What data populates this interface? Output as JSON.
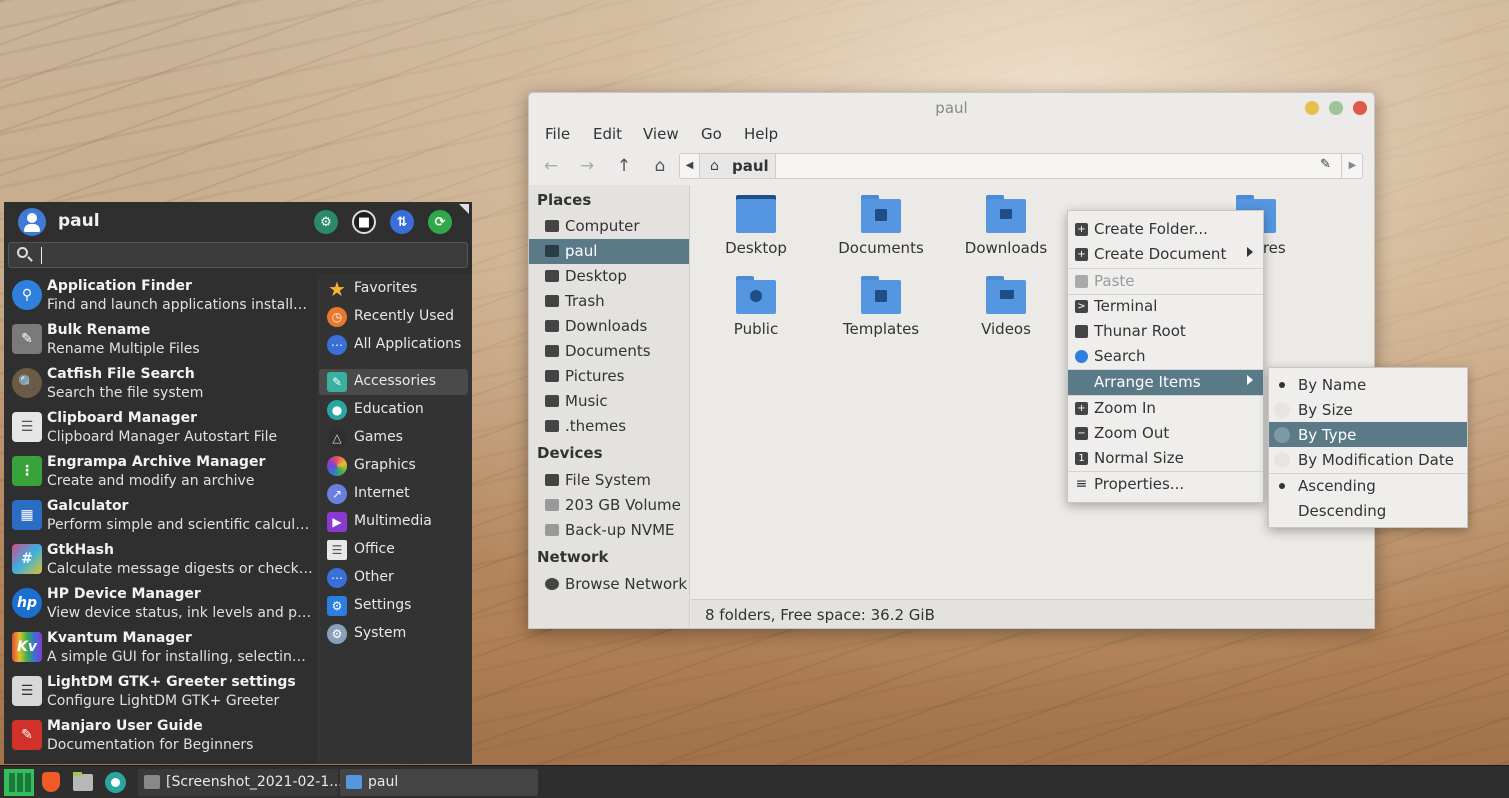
{
  "whisker_menu": {
    "username": "paul",
    "search_value": "",
    "applications": [
      {
        "name": "Application Finder",
        "desc": "Find and launch applications installe...",
        "icon": "search-icon",
        "color": "#2f7fdc"
      },
      {
        "name": "Bulk Rename",
        "desc": "Rename Multiple Files",
        "icon": "bulk-rename-icon",
        "color": "#7a7a7a"
      },
      {
        "name": "Catfish File Search",
        "desc": "Search the file system",
        "icon": "catfish-icon",
        "color": "#6b5a45"
      },
      {
        "name": "Clipboard Manager",
        "desc": "Clipboard Manager Autostart File",
        "icon": "clipboard-icon",
        "color": "#e6e6e6"
      },
      {
        "name": "Engrampa Archive Manager",
        "desc": "Create and modify an archive",
        "icon": "archive-icon",
        "color": "#3aa23a"
      },
      {
        "name": "Galculator",
        "desc": "Perform simple and scientific calcula...",
        "icon": "calculator-icon",
        "color": "#2b6cc4"
      },
      {
        "name": "GtkHash",
        "desc": "Calculate message digests or checks...",
        "icon": "hash-icon",
        "color": "#d24a8a"
      },
      {
        "name": "HP Device Manager",
        "desc": "View device status, ink levels and per...",
        "icon": "hp-icon",
        "color": "#1a6fd1"
      },
      {
        "name": "Kvantum Manager",
        "desc": "A simple GUI for installing, selecting ...",
        "icon": "kvantum-icon",
        "color": "#e04a3a"
      },
      {
        "name": "LightDM GTK+ Greeter settings",
        "desc": "Configure LightDM GTK+ Greeter",
        "icon": "settings-icon",
        "color": "#d8d8d8"
      },
      {
        "name": "Manjaro User Guide",
        "desc": "Documentation for Beginners",
        "icon": "pdf-icon",
        "color": "#d2302a"
      }
    ],
    "categories": [
      {
        "label": "Favorites",
        "icon": "star-icon",
        "color": "#f2b632"
      },
      {
        "label": "Recently Used",
        "icon": "clock-icon",
        "color": "#e8792c"
      },
      {
        "label": "All Applications",
        "icon": "grid-icon",
        "color": "#3a6fd8"
      },
      {
        "label": "Accessories",
        "icon": "accessories-icon",
        "color": "#3ab0a0"
      },
      {
        "label": "Education",
        "icon": "education-icon",
        "color": "#2aa6a0"
      },
      {
        "label": "Games",
        "icon": "gamepad-icon",
        "color": "#555555"
      },
      {
        "label": "Graphics",
        "icon": "graphics-icon",
        "color": "#e84e6a"
      },
      {
        "label": "Internet",
        "icon": "globe-icon",
        "color": "#6b7fe0"
      },
      {
        "label": "Multimedia",
        "icon": "multimedia-icon",
        "color": "#8a3ad0"
      },
      {
        "label": "Office",
        "icon": "office-icon",
        "color": "#e8e8e8"
      },
      {
        "label": "Other",
        "icon": "other-icon",
        "color": "#3a6fd8"
      },
      {
        "label": "Settings",
        "icon": "settings-icon",
        "color": "#2a7fe0"
      },
      {
        "label": "System",
        "icon": "system-icon",
        "color": "#8aa0b8"
      }
    ]
  },
  "panel": {
    "tasks": [
      {
        "label": "[Screenshot_2021-02-1...",
        "icon": "screenshot-icon"
      },
      {
        "label": "paul",
        "icon": "folder-icon"
      }
    ]
  },
  "thunar": {
    "title": "paul",
    "menu": [
      "File",
      "Edit",
      "View",
      "Go",
      "Help"
    ],
    "path_crumb": "paul",
    "sidebar": {
      "places_header": "Places",
      "places": [
        "Computer",
        "paul",
        "Desktop",
        "Trash",
        "Downloads",
        "Documents",
        "Pictures",
        "Music",
        ".themes"
      ],
      "devices_header": "Devices",
      "devices": [
        "File System",
        "203 GB Volume",
        "Back-up NVME"
      ],
      "network_header": "Network",
      "network": [
        "Browse Network"
      ]
    },
    "folders": [
      "Desktop",
      "Documents",
      "Downloads",
      "Public",
      "Templates",
      "Videos",
      "Pictures"
    ],
    "status": "8 folders, Free space: 36.2 GiB"
  },
  "context_menu": {
    "items": [
      {
        "label": "Create Folder...",
        "icon": "plus-icon"
      },
      {
        "label": "Create Document",
        "icon": "plus-icon",
        "submenu": true
      },
      {
        "label": "Paste",
        "icon": "paste-icon",
        "disabled": true
      },
      {
        "label": "Terminal",
        "icon": "terminal-icon"
      },
      {
        "label": "Thunar Root",
        "icon": "folder-icon"
      },
      {
        "label": "Search",
        "icon": "search-icon"
      },
      {
        "label": "Arrange Items",
        "submenu": true,
        "selected": true
      },
      {
        "label": "Zoom In",
        "icon": "zoom-in-icon"
      },
      {
        "label": "Zoom Out",
        "icon": "zoom-out-icon"
      },
      {
        "label": "Normal Size",
        "icon": "normal-size-icon"
      },
      {
        "label": "Properties...",
        "icon": "properties-icon"
      }
    ]
  },
  "arrange_submenu": {
    "items": [
      {
        "label": "By Name",
        "checked": true
      },
      {
        "label": "By Size",
        "checked": false
      },
      {
        "label": "By Type",
        "checked": false,
        "selected": true
      },
      {
        "label": "By Modification Date",
        "checked": false
      },
      {
        "label": "Ascending",
        "checked": true
      },
      {
        "label": "Descending",
        "checked": false
      }
    ]
  }
}
